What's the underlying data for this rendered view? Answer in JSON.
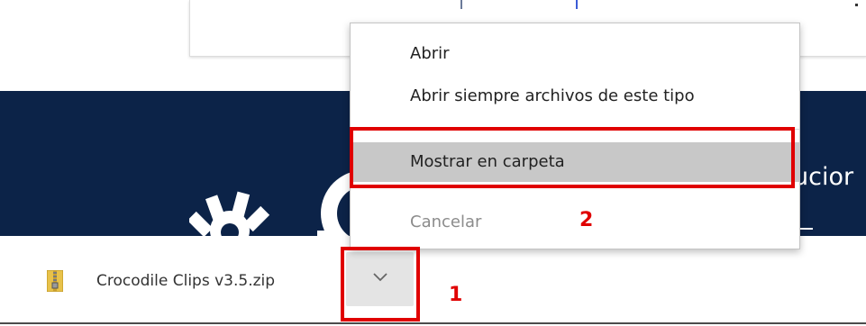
{
  "download": {
    "file_name": "Crocodile Clips v3.5.zip",
    "file_icon": "zip-archive-icon",
    "menu_button_icon": "chevron-down-icon"
  },
  "banner": {
    "partial_text": "ucior"
  },
  "context_menu": {
    "items": [
      {
        "label": "Abrir",
        "state": "normal"
      },
      {
        "label": "Abrir siempre archivos de este tipo",
        "state": "normal"
      },
      {
        "label": "Mostrar en carpeta",
        "state": "highlighted"
      },
      {
        "label": "Cancelar",
        "state": "disabled"
      }
    ]
  },
  "annotations": {
    "step1": "1",
    "step2": "2",
    "color": "#e00000"
  },
  "colors": {
    "banner_background": "#0c2348",
    "menu_highlight": "#c8c8c8",
    "button_background": "#e4e4e4"
  }
}
